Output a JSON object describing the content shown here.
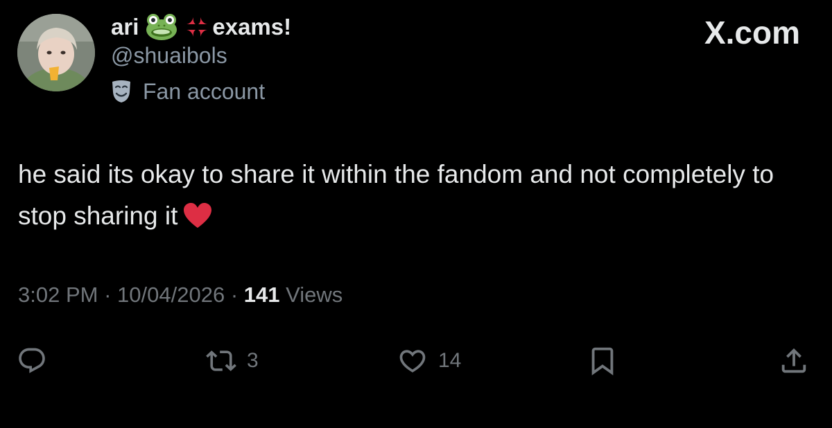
{
  "author": {
    "display_name_prefix": "ari",
    "display_name_suffix": "exams!",
    "name_emojis": [
      "frog-face",
      "anger-symbol"
    ],
    "handle": "@shuaibols",
    "label": "Fan account",
    "label_icon": "performing-arts-masks-icon"
  },
  "watermark": "X.com",
  "tweet": {
    "text": "he said its okay to share it within the fandom and not completely to stop sharing it",
    "trailing_emoji": "red-heart"
  },
  "meta": {
    "time": "3:02 PM",
    "separator": "·",
    "date": "10/04/2026",
    "views_count": "141",
    "views_label": "Views"
  },
  "actions": {
    "reply_count": "",
    "retweet_count": "3",
    "like_count": "14"
  },
  "colors": {
    "background": "#000000",
    "primary_text": "#e7e9ea",
    "secondary_text": "#71767b",
    "heart": "#dd2e44"
  }
}
